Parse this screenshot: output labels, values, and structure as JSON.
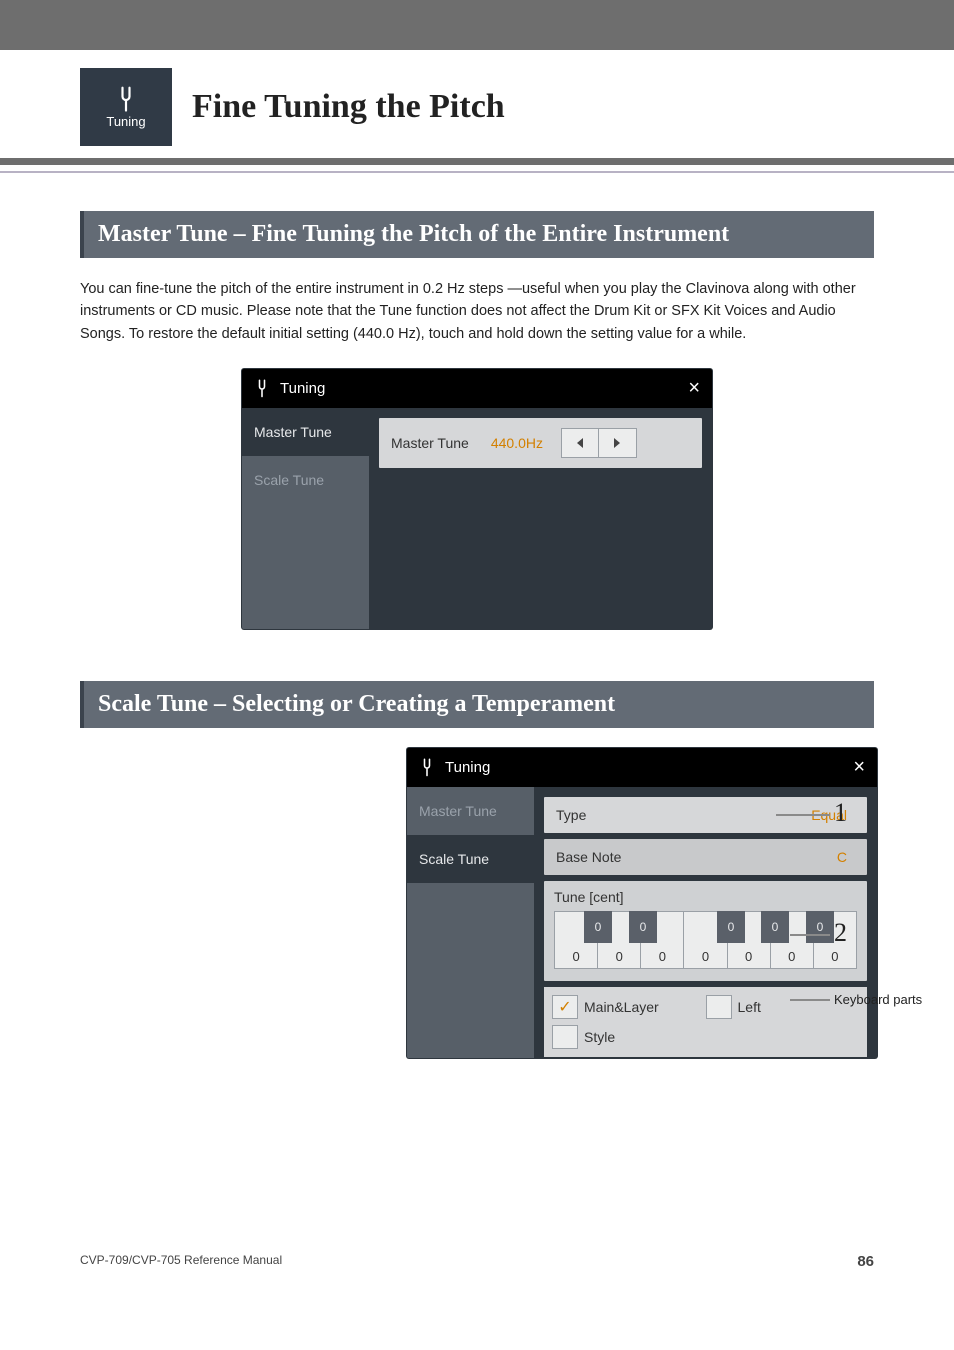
{
  "header": {
    "badge_label": "Tuning",
    "page_title": "Fine Tuning the Pitch"
  },
  "sections": {
    "master_title": "Master Tune – Fine Tuning the Pitch of the Entire Instrument",
    "master_body": "You can fine-tune the pitch of the entire instrument in 0.2 Hz steps —useful when you play the Clavinova along with other instruments or CD music. Please note that the Tune function does not affect the Drum Kit or SFX Kit Voices and Audio Songs. To restore the default initial setting (440.0 Hz), touch and hold down the setting value for a while.",
    "scale_title": "Scale Tune – Selecting or Creating a Temperament"
  },
  "shot_master": {
    "title": "Tuning",
    "sidebar": {
      "master": "Master Tune",
      "scale": "Scale Tune"
    },
    "row_label": "Master Tune",
    "row_value": "440.0Hz"
  },
  "shot_scale": {
    "title": "Tuning",
    "sidebar": {
      "master": "Master Tune",
      "scale": "Scale Tune"
    },
    "type_label": "Type",
    "type_value": "Equal",
    "base_label": "Base Note",
    "base_value": "C",
    "tune_label": "Tune [cent]",
    "white_vals": [
      "0",
      "0",
      "0",
      "0",
      "0",
      "0",
      "0"
    ],
    "black_vals": [
      "0",
      "0",
      "0",
      "0",
      "0"
    ],
    "parts": {
      "mainlayer": "Main&Layer",
      "left": "Left",
      "style": "Style"
    }
  },
  "callouts": {
    "one": "1",
    "two": "2",
    "kparts": "Keyboard parts"
  },
  "footer": {
    "ref": "CVP-709/CVP-705 Reference Manual",
    "page": "86"
  }
}
